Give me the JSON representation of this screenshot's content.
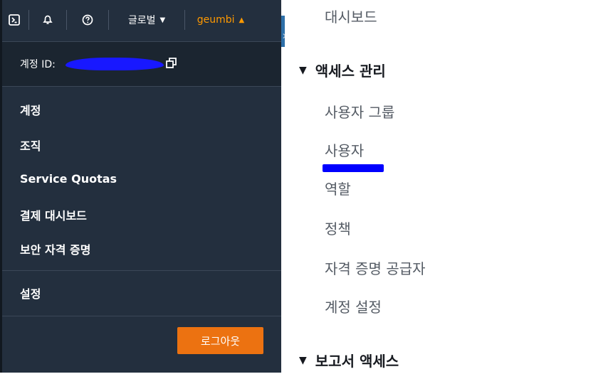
{
  "topbar": {
    "cloudshell_icon": "terminal-icon",
    "notifications_icon": "bell-icon",
    "help_icon": "help-circle-icon",
    "region_label": "글로벌",
    "region_caret": "▼",
    "user_label": "geumbi",
    "user_caret": "▲"
  },
  "account": {
    "id_label": "계정 ID:",
    "copy_icon": "copy-icon"
  },
  "menu": {
    "items": [
      "계정",
      "조직",
      "Service Quotas",
      "결제 대시보드",
      "보안 자격 증명"
    ],
    "settings": "설정",
    "logout": "로그아웃"
  },
  "iam_nav": {
    "dashboard": "대시보드",
    "access_management": {
      "title": "액세스 관리",
      "items": [
        "사용자 그룹",
        "사용자",
        "역할",
        "정책",
        "자격 증명 공급자",
        "계정 설정"
      ]
    },
    "reports": {
      "title": "보고서 액세스"
    },
    "caret": "▼"
  },
  "colors": {
    "panel_bg": "#232f3e",
    "accent_orange": "#ff9900",
    "logout_orange": "#ec7211",
    "redaction_blue": "#0000ff"
  }
}
